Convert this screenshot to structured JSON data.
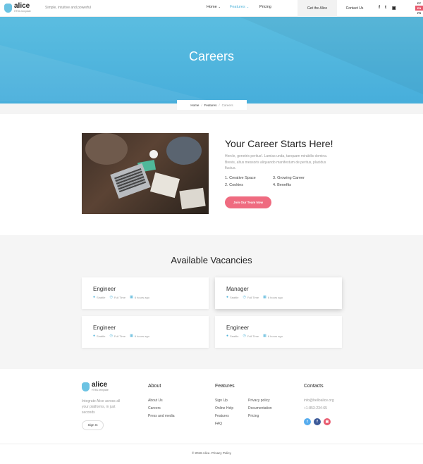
{
  "header": {
    "logo_name": "alice",
    "logo_sub": "HTML template",
    "tagline": "Simple, intuitive and powerful",
    "nav": [
      {
        "label": "Home",
        "has_dropdown": true
      },
      {
        "label": "Features",
        "has_dropdown": true,
        "active": true
      },
      {
        "label": "Pricing",
        "has_dropdown": false
      }
    ],
    "get_alice": "Get the Alice",
    "contact": "Contact Us",
    "social": [
      "f",
      "t",
      "i"
    ],
    "languages": [
      "DT",
      "EN",
      "FR"
    ],
    "current_language": "EN"
  },
  "hero": {
    "title": "Careers"
  },
  "breadcrumb": {
    "items": [
      "Home",
      "Features"
    ],
    "current": "Careers"
  },
  "career": {
    "title": "Your Career Starts Here!",
    "text": "Hercle, genetrix peritus!. Lamias unda, tanquam mirabilis domina. Brevis, altus messoris aliquando manifestum de peritus, placidus fluctus.",
    "benefits": [
      "1. Creative Space",
      "2. Cookies",
      "3. Growing Career",
      "4. Benefits"
    ],
    "button": "Join Our Team Now"
  },
  "vacancies": {
    "title": "Available Vacancies",
    "items": [
      {
        "title": "Engineer",
        "location": "Seattle",
        "type": "Full Time",
        "time": "6 hours ago"
      },
      {
        "title": "Manager",
        "location": "Seattle",
        "type": "Full Time",
        "time": "6 hours ago"
      },
      {
        "title": "Engineer",
        "location": "Seattle",
        "type": "Full Time",
        "time": "6 hours ago"
      },
      {
        "title": "Engineer",
        "location": "Seattle",
        "type": "Full Time",
        "time": "6 hours ago"
      }
    ]
  },
  "footer": {
    "logo_name": "alice",
    "logo_sub": "HTML template",
    "description": "Integrate Alice across all your platforms, in just seconds",
    "sign_in": "Sign In",
    "about": {
      "heading": "About",
      "links": [
        "About Us",
        "Careers",
        "Press and media"
      ]
    },
    "features": {
      "heading": "Features",
      "col1": [
        "Sign Up",
        "Online Help",
        "Features",
        "FAQ"
      ],
      "col2": [
        "Privacy policy",
        "Documentation",
        "Pricing"
      ]
    },
    "contact": {
      "heading": "Contacts",
      "email": "info@helloalice.org",
      "phone": "+1-853-234-65"
    },
    "social_colors": {
      "twitter": "#55acee",
      "facebook": "#3b5998",
      "instagram": "#e85a6e"
    },
    "copyright": "© 2018 Alice. Privacy Policy"
  },
  "colors": {
    "accent": "#4fb3d9",
    "cta": "#ef6b80"
  }
}
